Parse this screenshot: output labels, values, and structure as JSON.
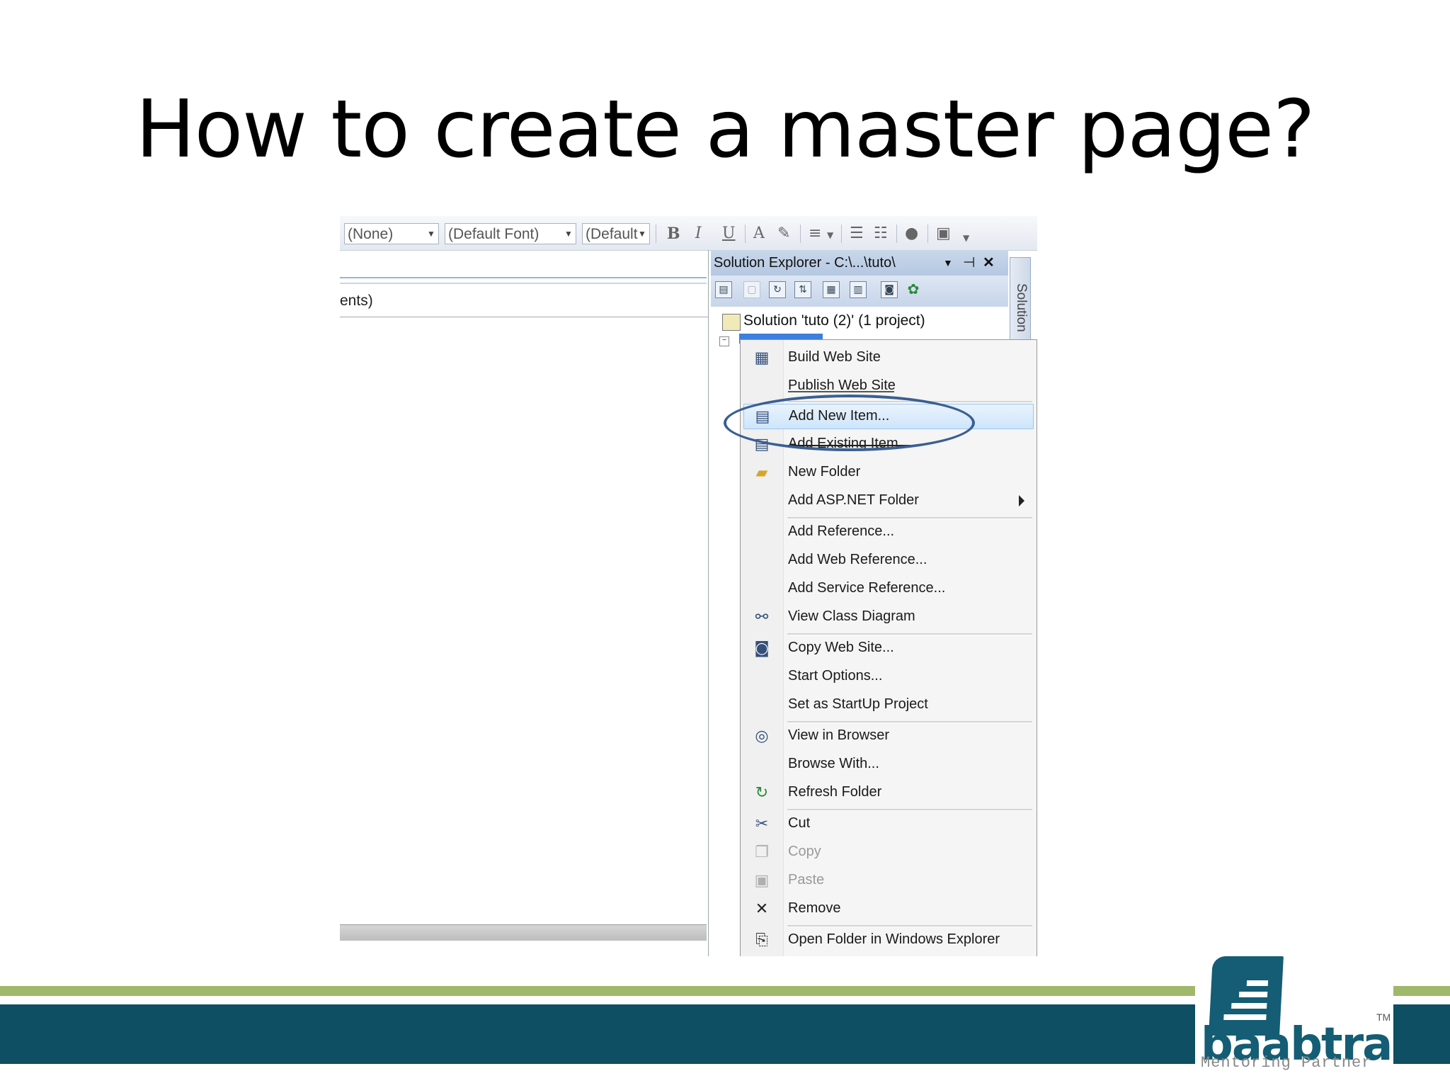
{
  "slide": {
    "title": "How to create a master page?"
  },
  "toolbar": {
    "style_combo": "(None)",
    "font_combo": "(Default Font)",
    "size_combo": "(Default",
    "bold": "B",
    "italic": "I",
    "underline": "U"
  },
  "editor": {
    "partial_text": "ents)"
  },
  "solution_explorer": {
    "title": "Solution Explorer - C:\\...\\tuto\\",
    "solution_node": "Solution 'tuto (2)' (1 project)",
    "side_tab": "Solution"
  },
  "context_menu": {
    "items": [
      {
        "label": "Build Web Site",
        "icon": "build-icon"
      },
      {
        "label": "Publish Web Site",
        "icon": ""
      },
      {
        "label": "Add New Item...",
        "icon": "new-item-icon"
      },
      {
        "label": "Add Existing Item...",
        "icon": "existing-item-icon"
      },
      {
        "label": "New Folder",
        "icon": "folder-icon"
      },
      {
        "label": "Add ASP.NET Folder",
        "icon": ""
      },
      {
        "label": "Add Reference...",
        "icon": ""
      },
      {
        "label": "Add Web Reference...",
        "icon": ""
      },
      {
        "label": "Add Service Reference...",
        "icon": ""
      },
      {
        "label": "View Class Diagram",
        "icon": "class-diagram-icon"
      },
      {
        "label": "Copy Web Site...",
        "icon": "copy-site-icon"
      },
      {
        "label": "Start Options...",
        "icon": ""
      },
      {
        "label": "Set as StartUp Project",
        "icon": ""
      },
      {
        "label": "View in Browser",
        "icon": "browser-icon"
      },
      {
        "label": "Browse With...",
        "icon": ""
      },
      {
        "label": "Refresh Folder",
        "icon": "refresh-icon"
      },
      {
        "label": "Cut",
        "icon": "cut-icon"
      },
      {
        "label": "Copy",
        "icon": "copy-icon"
      },
      {
        "label": "Paste",
        "icon": "paste-icon"
      },
      {
        "label": "Remove",
        "icon": "remove-icon"
      },
      {
        "label": "Open Folder in Windows Explorer",
        "icon": "open-folder-icon"
      }
    ]
  },
  "logo": {
    "wordmark": "baabtra",
    "tagline": "Mentoring Partner",
    "tm": "TM"
  }
}
